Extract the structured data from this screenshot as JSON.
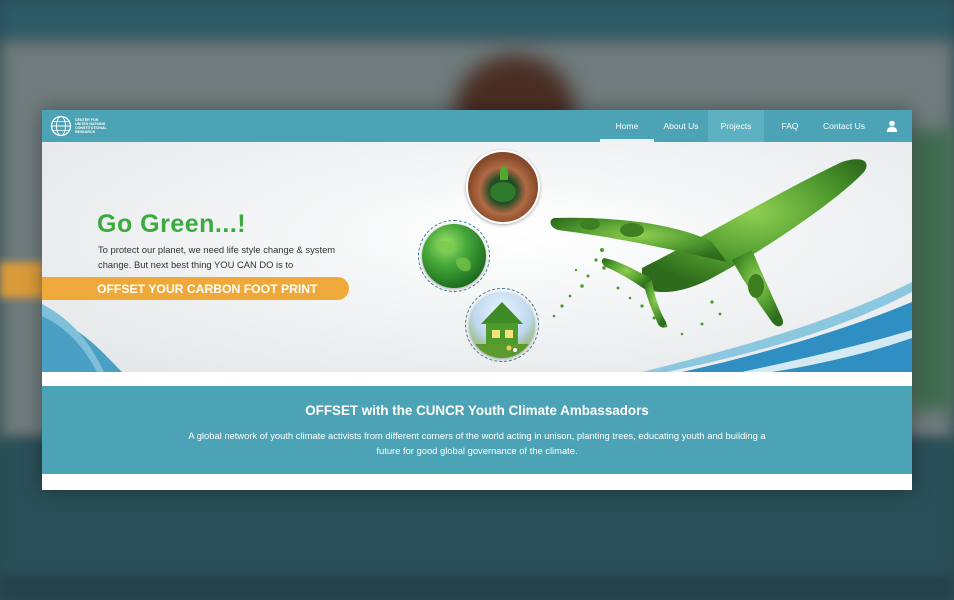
{
  "logo": {
    "text": "CENTER FOR\nUNITED NATIONS\nCONSTITUTIONAL\nRESEARCH",
    "icon": "globe-logo-icon"
  },
  "nav": {
    "items": [
      {
        "label": "Home",
        "state": "active"
      },
      {
        "label": "About Us",
        "state": "normal"
      },
      {
        "label": "Projects",
        "state": "hover"
      },
      {
        "label": "FAQ",
        "state": "normal"
      },
      {
        "label": "Contact Us",
        "state": "normal"
      }
    ],
    "user_icon": "user-icon"
  },
  "hero": {
    "title": "Go Green...!",
    "text": "To protect our planet, we need life style change & system change. But next best thing YOU CAN DO is to",
    "cta": "OFFSET YOUR CARBON FOOT PRINT",
    "images": [
      "hands-sapling-image",
      "green-globe-image",
      "grass-house-image",
      "grass-airplane-image"
    ]
  },
  "band": {
    "title": "OFFSET with the CUNCR Youth Climate Ambassadors",
    "text": "A global network of youth climate activists from different corners of the world acting in unison, planting trees, educating youth and building a future for good global governance of the climate."
  },
  "colors": {
    "teal": "#4ca3b5",
    "green": "#3aab3c",
    "orange": "#efa93a",
    "backdrop": "#2c4a52"
  }
}
